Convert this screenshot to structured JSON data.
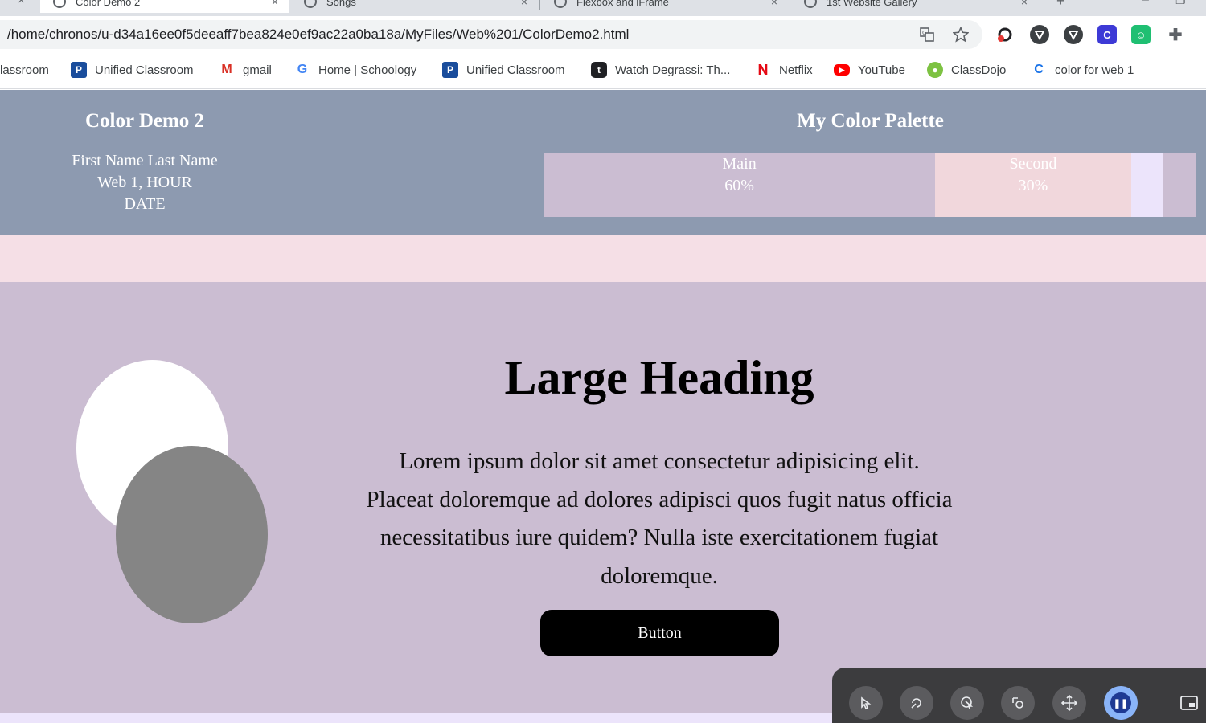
{
  "browser": {
    "tabs": [
      {
        "title": "Color Demo 2",
        "active": true
      },
      {
        "title": "Songs",
        "active": false
      },
      {
        "title": "Flexbox and iFrame",
        "active": false
      },
      {
        "title": "1st Website Gallery",
        "active": false
      }
    ],
    "url": "/home/chronos/u-d34a16ee0f5deeaff7bea824e0ef9ac22a0ba18a/MyFiles/Web%201/ColorDemo2.html",
    "close_glyph": "×",
    "new_tab_glyph": "+",
    "window_controls": {
      "minimize": "–",
      "maximize": "❐"
    },
    "omnibox_icons": [
      "translate-icon",
      "bookmark-star-icon"
    ],
    "extension_icons": [
      "color-picker-icon",
      "shield-icon",
      "shield-icon",
      "c-extension-icon",
      "smiley-extension-icon",
      "puzzle-icon"
    ],
    "bookmarks": [
      {
        "label": "lassroom",
        "icon": "classroom-icon"
      },
      {
        "label": "Unified Classroom",
        "icon": "p-icon"
      },
      {
        "label": "gmail",
        "icon": "gmail-icon"
      },
      {
        "label": "Home | Schoology",
        "icon": "google-icon"
      },
      {
        "label": "Unified Classroom",
        "icon": "p-icon"
      },
      {
        "label": "Watch Degrassi: Th...",
        "icon": "t-icon"
      },
      {
        "label": "Netflix",
        "icon": "netflix-icon"
      },
      {
        "label": "YouTube",
        "icon": "youtube-icon"
      },
      {
        "label": "ClassDojo",
        "icon": "classdojo-icon"
      },
      {
        "label": "color for web 1",
        "icon": "c-icon"
      }
    ]
  },
  "header": {
    "title": "Color Demo 2",
    "name": "First Name Last Name",
    "class_line": "Web 1, HOUR",
    "date": "DATE",
    "palette_title": "My Color Palette",
    "swatches": [
      {
        "label": "Main",
        "percent": "60%",
        "color": "#cbbdd2",
        "share": 60
      },
      {
        "label": "Second",
        "percent": "30%",
        "color": "#f1d7dc",
        "share": 30
      },
      {
        "label": "",
        "percent": "",
        "color": "#ece4fb",
        "share": 5
      },
      {
        "label": "",
        "percent": "",
        "color": "#cbbdd2",
        "share": 5
      }
    ]
  },
  "hero": {
    "heading": "Large Heading",
    "body": "Lorem ipsum dolor sit amet consectetur adipisicing elit. Placeat doloremque ad dolores adipisci quos fugit natus officia necessitatibus iure quidem? Nulla iste exercitationem fugiat doloremque.",
    "button_label": "Button",
    "circle_colors": [
      "#ffffff",
      "#858585"
    ]
  },
  "colors": {
    "header_bg": "#8d9ab0",
    "band_bg": "#f5dfe6",
    "hero_bg": "#cbbdd2",
    "accent_strip": "#ece4fb"
  },
  "control_bar": {
    "buttons": [
      "click-icon",
      "rotate-click-icon",
      "double-click-icon",
      "drag-icon",
      "move-icon",
      "pause-icon"
    ],
    "pip_icon": "picture-in-picture-icon"
  }
}
